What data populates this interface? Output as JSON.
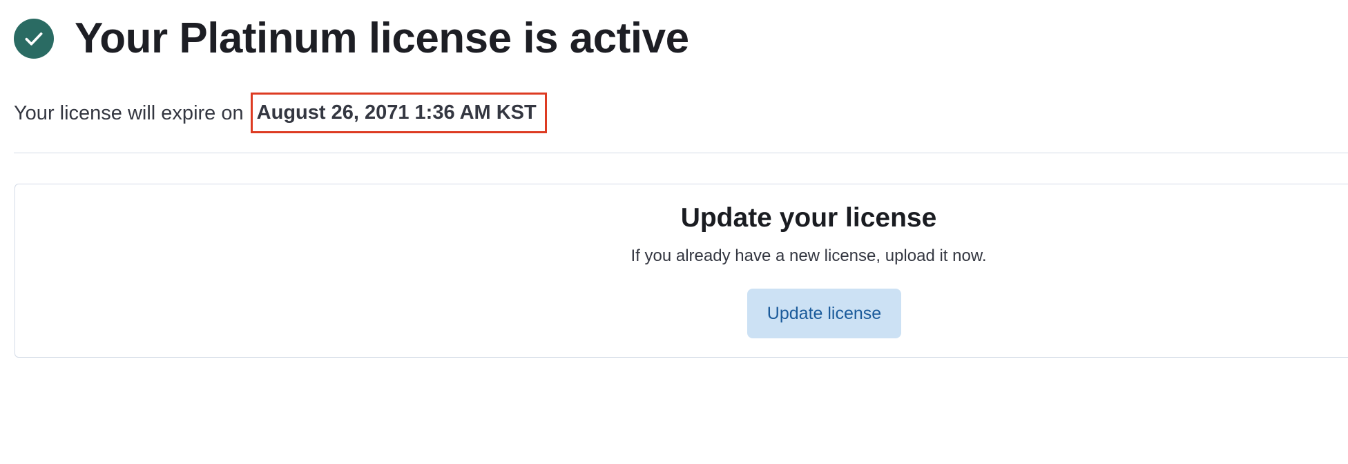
{
  "header": {
    "title": "Your Platinum license is active",
    "status_icon": "check-circle-icon",
    "status_color": "#2a6b63"
  },
  "expiry": {
    "prefix": "Your license will expire on",
    "date": "August 26, 2071 1:36 AM KST",
    "highlight_color": "#dd3b22"
  },
  "update_panel": {
    "title": "Update your license",
    "description": "If you already have a new license, upload it now.",
    "button_label": "Update license",
    "button_bg": "#cce1f4",
    "button_text_color": "#1a5a9a"
  }
}
